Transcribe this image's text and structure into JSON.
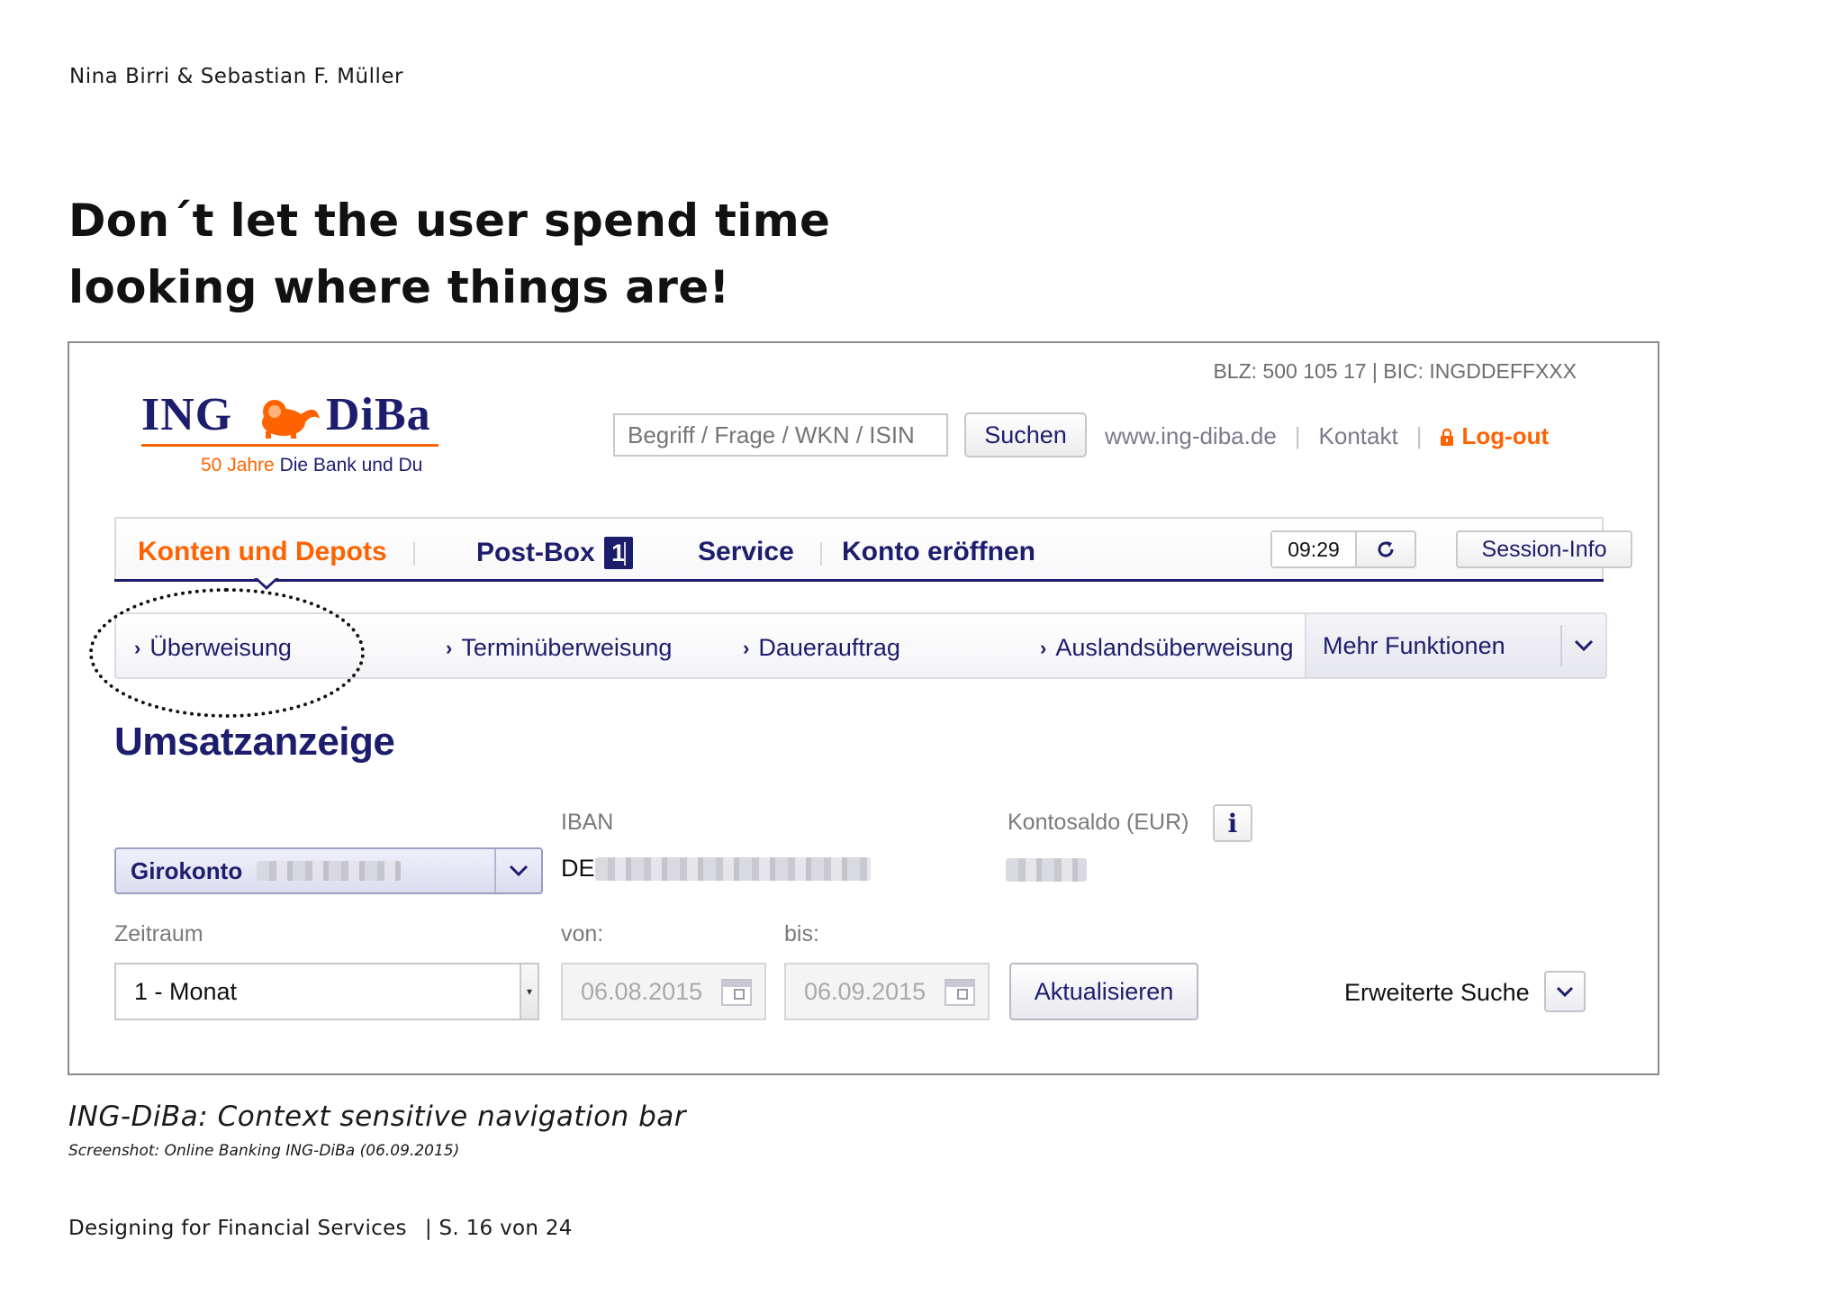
{
  "doc": {
    "author": "Nina Birri & Sebastian F. Müller",
    "headline_line1": "Don´t let the user spend time",
    "headline_line2": "looking where things are!",
    "caption": "ING-DiBa: Context sensitive navigation bar",
    "subcaption": "Screenshot: Online Banking ING-DiBa (06.09.2015)",
    "footer_title": "Designing for Financial Services",
    "footer_page": "| S. 16 von 24"
  },
  "bank": {
    "blz_bic": "BLZ: 500 105 17 | BIC: INGDDEFFXXX",
    "logo": {
      "word1": "ING",
      "word2": "DiBa",
      "tag1": "50 Jahre",
      "tag2": "Die Bank und Du"
    },
    "search": {
      "placeholder": "Begriff / Frage / WKN / ISIN",
      "button": "Suchen"
    },
    "toplinks": {
      "website": "www.ing-diba.de",
      "contact": "Kontakt",
      "logout": "Log-out"
    },
    "mainnav": {
      "items": [
        "Konten und Depots",
        "Post-Box",
        "Service",
        "Konto eröffnen"
      ],
      "postbox_count": "1",
      "timer": "09:29",
      "session": "Session-Info",
      "active_color": "#ff6200",
      "brand_color": "#1d1d6e"
    },
    "subnav": {
      "items": [
        "Überweisung",
        "Terminüberweisung",
        "Dauerauftrag",
        "Auslandsüberweisung"
      ],
      "more": "Mehr Funktionen"
    },
    "content": {
      "title": "Umsatzanzeige",
      "iban_label": "IBAN",
      "iban_prefix": "DE",
      "saldo_label": "Kontosaldo (EUR)",
      "account": "Girokonto",
      "zeitraum_label": "Zeitraum",
      "zeitraum_value": "1 - Monat",
      "von_label": "von:",
      "von_value": "06.08.2015",
      "bis_label": "bis:",
      "bis_value": "06.09.2015",
      "refresh_button": "Aktualisieren",
      "extended_search": "Erweiterte Suche"
    }
  }
}
